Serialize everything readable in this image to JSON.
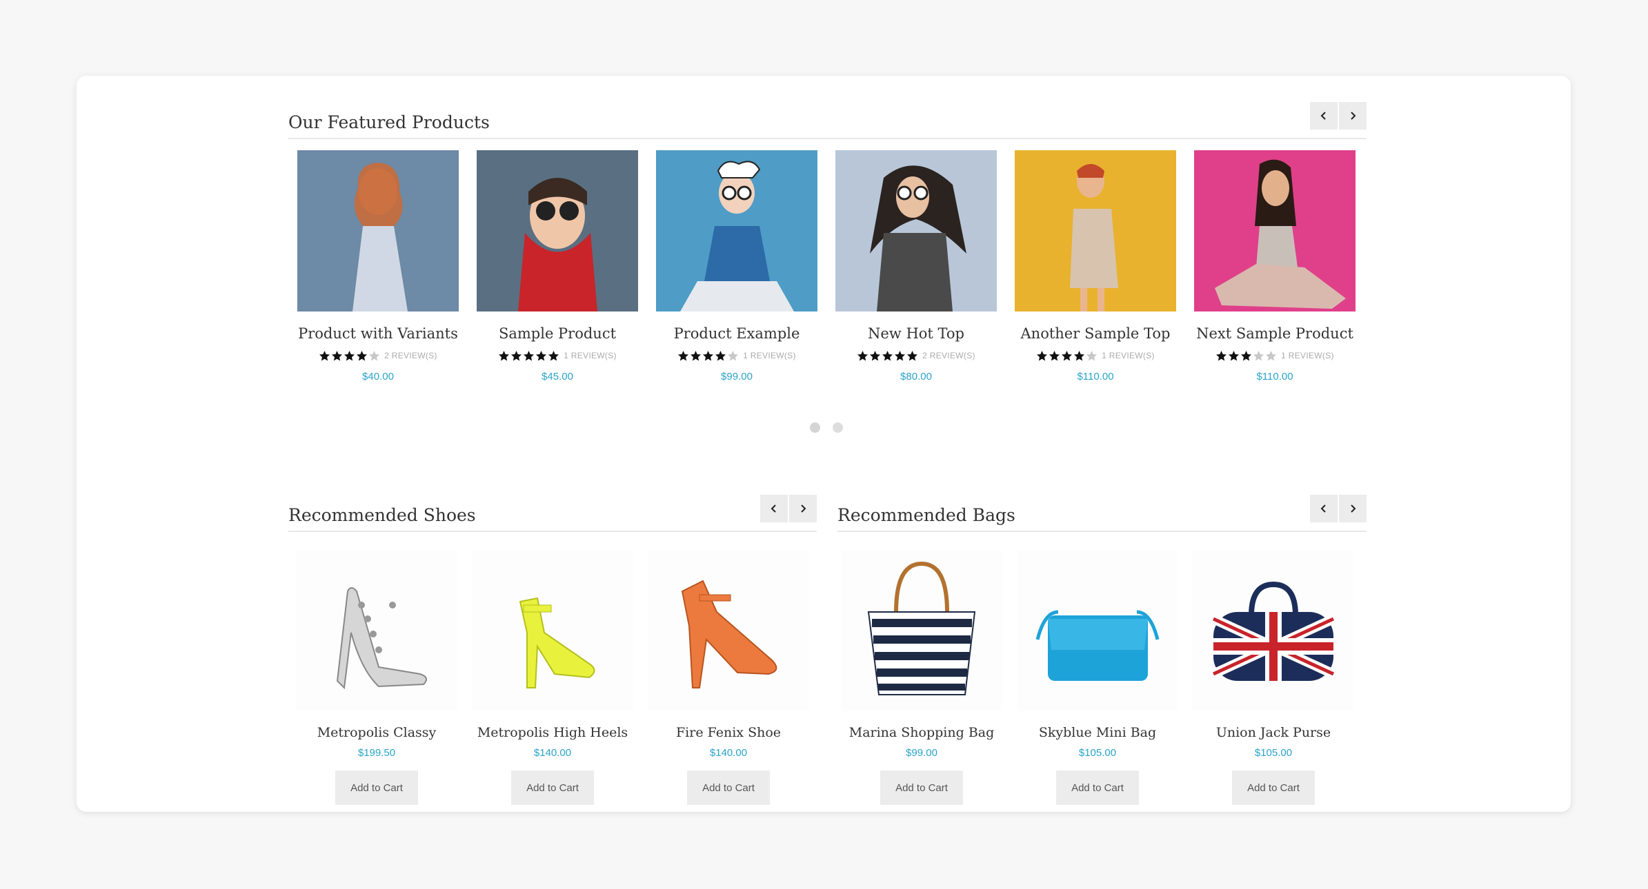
{
  "featured": {
    "title": "Our Featured Products",
    "products": [
      {
        "name": "Product with Variants",
        "rating": 4,
        "reviews": "2 REVIEW(S)",
        "price": "$40.00",
        "bg": "#6d8aa6"
      },
      {
        "name": "Sample Product",
        "rating": 5,
        "reviews": "1 REVIEW(S)",
        "price": "$45.00",
        "bg": "#5a6f82"
      },
      {
        "name": "Product Example",
        "rating": 4,
        "reviews": "1 REVIEW(S)",
        "price": "$99.00",
        "bg": "#4f9cc6"
      },
      {
        "name": "New Hot Top",
        "rating": 5,
        "reviews": "2 REVIEW(S)",
        "price": "$80.00",
        "bg": "#b8c6d8"
      },
      {
        "name": "Another Sample Top",
        "rating": 4,
        "reviews": "1 REVIEW(S)",
        "price": "$110.00",
        "bg": "#e8b22e"
      },
      {
        "name": "Next Sample Product",
        "rating": 3,
        "reviews": "1 REVIEW(S)",
        "price": "$110.00",
        "bg": "#e0408a"
      }
    ],
    "pages": 2,
    "active_page": 1
  },
  "shoes": {
    "title": "Recommended Shoes",
    "products": [
      {
        "name": "Metropolis Classy",
        "price": "$199.50",
        "cart": "Add to Cart",
        "color": "#c9c9c9"
      },
      {
        "name": "Metropolis High Heels",
        "price": "$140.00",
        "cart": "Add to Cart",
        "color": "#e8f23c"
      },
      {
        "name": "Fire Fenix Shoe",
        "price": "$140.00",
        "cart": "Add to Cart",
        "color": "#ec7a3e"
      }
    ]
  },
  "bags": {
    "title": "Recommended Bags",
    "products": [
      {
        "name": "Marina Shopping Bag",
        "price": "$99.00",
        "cart": "Add to Cart",
        "color": "#1e2a44"
      },
      {
        "name": "Skyblue Mini Bag",
        "price": "$105.00",
        "cart": "Add to Cart",
        "color": "#1ea3d8"
      },
      {
        "name": "Union Jack Purse",
        "price": "$105.00",
        "cart": "Add to Cart",
        "color": "#1c2d5a"
      }
    ]
  },
  "icons": {
    "prev": "chevron-left-icon",
    "next": "chevron-right-icon",
    "star": "star-icon"
  }
}
